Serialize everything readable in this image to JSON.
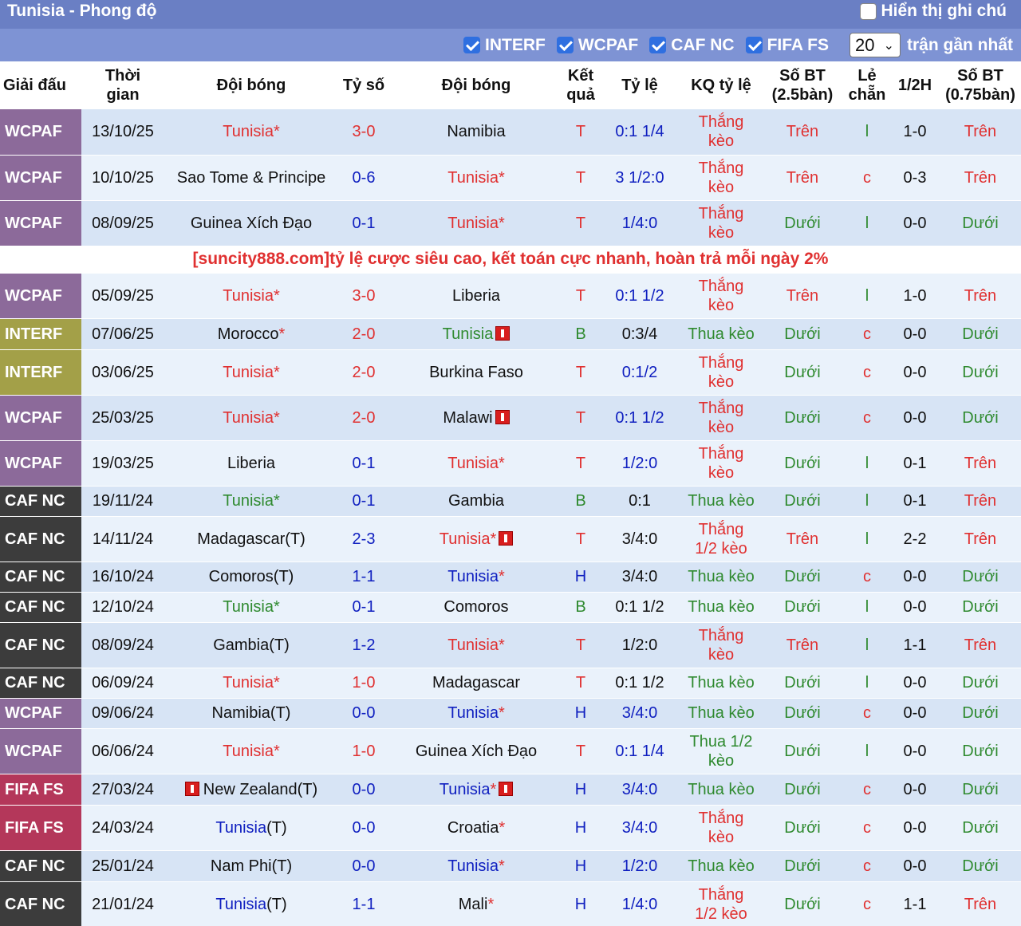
{
  "title": "Tunisia - Phong độ",
  "show_notes_label": "Hiển thị ghi chú",
  "filters": [
    {
      "label": "INTERF",
      "checked": true
    },
    {
      "label": "WCPAF",
      "checked": true
    },
    {
      "label": "CAF NC",
      "checked": true
    },
    {
      "label": "FIFA FS",
      "checked": true
    }
  ],
  "recent_count": "20",
  "recent_suffix": "trận gần nhất",
  "headers": {
    "league": "Giải đấu",
    "time_1": "Thời",
    "time_2": "gian",
    "home": "Đội bóng",
    "score": "Tỷ số",
    "away": "Đội bóng",
    "result_1": "Kết",
    "result_2": "quả",
    "odds": "Tỷ lệ",
    "odds_result": "KQ tỷ lệ",
    "total_1": "Số BT",
    "total_2": "(2.5bàn)",
    "oddeven_1": "Lẻ",
    "oddeven_2": "chẵn",
    "half": "1/2H",
    "total_half_1": "Số BT",
    "total_half_2": "(0.75bàn)"
  },
  "promo": "[suncity888.com]tỷ lệ cược siêu cao, kết toán cực nhanh, hoàn trả mỗi ngày 2%",
  "colors": {
    "title_bar": "#6a7fc4",
    "filter_bar": "#7e93d4",
    "row_dark": "#d7e4f5",
    "row_light": "#eaf2fb",
    "WCPAF": "#8c6a9a",
    "INTERF": "#a3a048",
    "CAF NC": "#3c3c3c",
    "FIFA FS": "#b4375a",
    "win": "#e03030",
    "lose": "#2f8a2f",
    "draw": "#1020c0"
  },
  "rows": [
    {
      "league": "WCPAF",
      "date": "13/10/25",
      "home": "Tunisia",
      "home_star": "*",
      "home_color": "red",
      "score": "3-0",
      "score_color": "red",
      "away": "Namibia",
      "away_star": "",
      "away_color": "dark",
      "result": "T",
      "result_color": "red",
      "odds": "0:1 1/4",
      "odds_color": "blue",
      "odds_result_1": "Thắng",
      "odds_result_2": "kèo",
      "odds_result_color": "red",
      "total": "Trên",
      "total_color": "red",
      "oddeven": "l",
      "oddeven_color": "green",
      "half": "1-0",
      "total_half": "Trên",
      "total_half_color": "red"
    },
    {
      "league": "WCPAF",
      "date": "10/10/25",
      "home": "Sao Tome & Principe",
      "home_star": "",
      "home_color": "dark",
      "score": "0-6",
      "score_color": "blue",
      "away": "Tunisia",
      "away_star": "*",
      "away_color": "red",
      "result": "T",
      "result_color": "red",
      "odds": "3 1/2:0",
      "odds_color": "blue",
      "odds_result_1": "Thắng",
      "odds_result_2": "kèo",
      "odds_result_color": "red",
      "total": "Trên",
      "total_color": "red",
      "oddeven": "c",
      "oddeven_color": "red",
      "half": "0-3",
      "total_half": "Trên",
      "total_half_color": "red"
    },
    {
      "league": "WCPAF",
      "date": "08/09/25",
      "home": "Guinea Xích Đạo",
      "home_star": "",
      "home_color": "dark",
      "score": "0-1",
      "score_color": "blue",
      "away": "Tunisia",
      "away_star": "*",
      "away_color": "red",
      "result": "T",
      "result_color": "red",
      "odds": "1/4:0",
      "odds_color": "blue",
      "odds_result_1": "Thắng",
      "odds_result_2": "kèo",
      "odds_result_color": "red",
      "total": "Dưới",
      "total_color": "green",
      "oddeven": "l",
      "oddeven_color": "green",
      "half": "0-0",
      "total_half": "Dưới",
      "total_half_color": "green"
    },
    {
      "promo": true
    },
    {
      "league": "WCPAF",
      "date": "05/09/25",
      "home": "Tunisia",
      "home_star": "*",
      "home_color": "red",
      "score": "3-0",
      "score_color": "red",
      "away": "Liberia",
      "away_star": "",
      "away_color": "dark",
      "result": "T",
      "result_color": "red",
      "odds": "0:1 1/2",
      "odds_color": "blue",
      "odds_result_1": "Thắng",
      "odds_result_2": "kèo",
      "odds_result_color": "red",
      "total": "Trên",
      "total_color": "red",
      "oddeven": "l",
      "oddeven_color": "green",
      "half": "1-0",
      "total_half": "Trên",
      "total_half_color": "red"
    },
    {
      "league": "INTERF",
      "date": "07/06/25",
      "home": "Morocco",
      "home_star": "*",
      "home_color": "dark",
      "score": "2-0",
      "score_color": "red",
      "away": "Tunisia",
      "away_star": "",
      "away_color": "green",
      "away_card": true,
      "result": "B",
      "result_color": "green",
      "odds": "0:3/4",
      "odds_color": "dark",
      "odds_result_1": "Thua kèo",
      "odds_result_2": "",
      "odds_result_color": "green",
      "total": "Dưới",
      "total_color": "green",
      "oddeven": "c",
      "oddeven_color": "red",
      "half": "0-0",
      "total_half": "Dưới",
      "total_half_color": "green"
    },
    {
      "league": "INTERF",
      "date": "03/06/25",
      "home": "Tunisia",
      "home_star": "*",
      "home_color": "red",
      "score": "2-0",
      "score_color": "red",
      "away": "Burkina Faso",
      "away_star": "",
      "away_color": "dark",
      "result": "T",
      "result_color": "red",
      "odds": "0:1/2",
      "odds_color": "blue",
      "odds_result_1": "Thắng",
      "odds_result_2": "kèo",
      "odds_result_color": "red",
      "total": "Dưới",
      "total_color": "green",
      "oddeven": "c",
      "oddeven_color": "red",
      "half": "0-0",
      "total_half": "Dưới",
      "total_half_color": "green"
    },
    {
      "league": "WCPAF",
      "date": "25/03/25",
      "home": "Tunisia",
      "home_star": "*",
      "home_color": "red",
      "score": "2-0",
      "score_color": "red",
      "away": "Malawi",
      "away_star": "",
      "away_color": "dark",
      "away_card": true,
      "result": "T",
      "result_color": "red",
      "odds": "0:1 1/2",
      "odds_color": "blue",
      "odds_result_1": "Thắng",
      "odds_result_2": "kèo",
      "odds_result_color": "red",
      "total": "Dưới",
      "total_color": "green",
      "oddeven": "c",
      "oddeven_color": "red",
      "half": "0-0",
      "total_half": "Dưới",
      "total_half_color": "green"
    },
    {
      "league": "WCPAF",
      "date": "19/03/25",
      "home": "Liberia",
      "home_star": "",
      "home_color": "dark",
      "score": "0-1",
      "score_color": "blue",
      "away": "Tunisia",
      "away_star": "*",
      "away_color": "red",
      "result": "T",
      "result_color": "red",
      "odds": "1/2:0",
      "odds_color": "blue",
      "odds_result_1": "Thắng",
      "odds_result_2": "kèo",
      "odds_result_color": "red",
      "total": "Dưới",
      "total_color": "green",
      "oddeven": "l",
      "oddeven_color": "green",
      "half": "0-1",
      "total_half": "Trên",
      "total_half_color": "red"
    },
    {
      "league": "CAF NC",
      "date": "19/11/24",
      "home": "Tunisia",
      "home_star": "*",
      "home_color": "green",
      "score": "0-1",
      "score_color": "blue",
      "away": "Gambia",
      "away_star": "",
      "away_color": "dark",
      "result": "B",
      "result_color": "green",
      "odds": "0:1",
      "odds_color": "dark",
      "odds_result_1": "Thua kèo",
      "odds_result_2": "",
      "odds_result_color": "green",
      "total": "Dưới",
      "total_color": "green",
      "oddeven": "l",
      "oddeven_color": "green",
      "half": "0-1",
      "total_half": "Trên",
      "total_half_color": "red"
    },
    {
      "league": "CAF NC",
      "date": "14/11/24",
      "home": "Madagascar(T)",
      "home_star": "",
      "home_color": "dark",
      "score": "2-3",
      "score_color": "blue",
      "away": "Tunisia",
      "away_star": "*",
      "away_color": "red",
      "away_card": true,
      "result": "T",
      "result_color": "red",
      "odds": "3/4:0",
      "odds_color": "dark",
      "odds_result_1": "Thắng",
      "odds_result_2": "1/2 kèo",
      "odds_result_color": "red",
      "total": "Trên",
      "total_color": "red",
      "oddeven": "l",
      "oddeven_color": "green",
      "half": "2-2",
      "total_half": "Trên",
      "total_half_color": "red"
    },
    {
      "league": "CAF NC",
      "date": "16/10/24",
      "home": "Comoros(T)",
      "home_star": "",
      "home_color": "dark",
      "score": "1-1",
      "score_color": "blue",
      "away": "Tunisia",
      "away_star": "*",
      "away_color": "blue",
      "result": "H",
      "result_color": "blue",
      "odds": "3/4:0",
      "odds_color": "dark",
      "odds_result_1": "Thua kèo",
      "odds_result_2": "",
      "odds_result_color": "green",
      "total": "Dưới",
      "total_color": "green",
      "oddeven": "c",
      "oddeven_color": "red",
      "half": "0-0",
      "total_half": "Dưới",
      "total_half_color": "green"
    },
    {
      "league": "CAF NC",
      "date": "12/10/24",
      "home": "Tunisia",
      "home_star": "*",
      "home_color": "green",
      "score": "0-1",
      "score_color": "blue",
      "away": "Comoros",
      "away_star": "",
      "away_color": "dark",
      "result": "B",
      "result_color": "green",
      "odds": "0:1 1/2",
      "odds_color": "dark",
      "odds_result_1": "Thua kèo",
      "odds_result_2": "",
      "odds_result_color": "green",
      "total": "Dưới",
      "total_color": "green",
      "oddeven": "l",
      "oddeven_color": "green",
      "half": "0-0",
      "total_half": "Dưới",
      "total_half_color": "green"
    },
    {
      "league": "CAF NC",
      "date": "08/09/24",
      "home": "Gambia(T)",
      "home_star": "",
      "home_color": "dark",
      "score": "1-2",
      "score_color": "blue",
      "away": "Tunisia",
      "away_star": "*",
      "away_color": "red",
      "result": "T",
      "result_color": "red",
      "odds": "1/2:0",
      "odds_color": "dark",
      "odds_result_1": "Thắng",
      "odds_result_2": "kèo",
      "odds_result_color": "red",
      "total": "Trên",
      "total_color": "red",
      "oddeven": "l",
      "oddeven_color": "green",
      "half": "1-1",
      "total_half": "Trên",
      "total_half_color": "red"
    },
    {
      "league": "CAF NC",
      "date": "06/09/24",
      "home": "Tunisia",
      "home_star": "*",
      "home_color": "red",
      "score": "1-0",
      "score_color": "red",
      "away": "Madagascar",
      "away_star": "",
      "away_color": "dark",
      "result": "T",
      "result_color": "red",
      "odds": "0:1 1/2",
      "odds_color": "dark",
      "odds_result_1": "Thua kèo",
      "odds_result_2": "",
      "odds_result_color": "green",
      "total": "Dưới",
      "total_color": "green",
      "oddeven": "l",
      "oddeven_color": "green",
      "half": "0-0",
      "total_half": "Dưới",
      "total_half_color": "green"
    },
    {
      "league": "WCPAF",
      "date": "09/06/24",
      "home": "Namibia(T)",
      "home_star": "",
      "home_color": "dark",
      "score": "0-0",
      "score_color": "blue",
      "away": "Tunisia",
      "away_star": "*",
      "away_color": "blue",
      "result": "H",
      "result_color": "blue",
      "odds": "3/4:0",
      "odds_color": "blue",
      "odds_result_1": "Thua kèo",
      "odds_result_2": "",
      "odds_result_color": "green",
      "total": "Dưới",
      "total_color": "green",
      "oddeven": "c",
      "oddeven_color": "red",
      "half": "0-0",
      "total_half": "Dưới",
      "total_half_color": "green"
    },
    {
      "league": "WCPAF",
      "date": "06/06/24",
      "home": "Tunisia",
      "home_star": "*",
      "home_color": "red",
      "score": "1-0",
      "score_color": "red",
      "away": "Guinea Xích Đạo",
      "away_star": "",
      "away_color": "dark",
      "result": "T",
      "result_color": "red",
      "odds": "0:1 1/4",
      "odds_color": "blue",
      "odds_result_1": "Thua 1/2",
      "odds_result_2": "kèo",
      "odds_result_color": "green",
      "total": "Dưới",
      "total_color": "green",
      "oddeven": "l",
      "oddeven_color": "green",
      "half": "0-0",
      "total_half": "Dưới",
      "total_half_color": "green"
    },
    {
      "league": "FIFA FS",
      "date": "27/03/24",
      "home": "New Zealand(T)",
      "home_star": "",
      "home_color": "dark",
      "home_card": true,
      "score": "0-0",
      "score_color": "blue",
      "away": "Tunisia",
      "away_star": "*",
      "away_color": "blue",
      "away_card": true,
      "result": "H",
      "result_color": "blue",
      "odds": "3/4:0",
      "odds_color": "blue",
      "odds_result_1": "Thua kèo",
      "odds_result_2": "",
      "odds_result_color": "green",
      "total": "Dưới",
      "total_color": "green",
      "oddeven": "c",
      "oddeven_color": "red",
      "half": "0-0",
      "total_half": "Dưới",
      "total_half_color": "green"
    },
    {
      "league": "FIFA FS",
      "date": "24/03/24",
      "home": "Tunisia",
      "home_suffix": "(T)",
      "home_star": "",
      "home_color": "blue",
      "score": "0-0",
      "score_color": "blue",
      "away": "Croatia",
      "away_star": "*",
      "away_color": "dark",
      "result": "H",
      "result_color": "blue",
      "odds": "3/4:0",
      "odds_color": "blue",
      "odds_result_1": "Thắng",
      "odds_result_2": "kèo",
      "odds_result_color": "red",
      "total": "Dưới",
      "total_color": "green",
      "oddeven": "c",
      "oddeven_color": "red",
      "half": "0-0",
      "total_half": "Dưới",
      "total_half_color": "green"
    },
    {
      "league": "CAF NC",
      "date": "25/01/24",
      "home": "Nam Phi(T)",
      "home_star": "",
      "home_color": "dark",
      "score": "0-0",
      "score_color": "blue",
      "away": "Tunisia",
      "away_star": "*",
      "away_color": "blue",
      "result": "H",
      "result_color": "blue",
      "odds": "1/2:0",
      "odds_color": "blue",
      "odds_result_1": "Thua kèo",
      "odds_result_2": "",
      "odds_result_color": "green",
      "total": "Dưới",
      "total_color": "green",
      "oddeven": "c",
      "oddeven_color": "red",
      "half": "0-0",
      "total_half": "Dưới",
      "total_half_color": "green"
    },
    {
      "league": "CAF NC",
      "date": "21/01/24",
      "home": "Tunisia",
      "home_suffix": "(T)",
      "home_star": "",
      "home_color": "blue",
      "score": "1-1",
      "score_color": "blue",
      "away": "Mali",
      "away_star": "*",
      "away_color": "dark",
      "result": "H",
      "result_color": "blue",
      "odds": "1/4:0",
      "odds_color": "blue",
      "odds_result_1": "Thắng",
      "odds_result_2": "1/2 kèo",
      "odds_result_color": "red",
      "total": "Dưới",
      "total_color": "green",
      "oddeven": "c",
      "oddeven_color": "red",
      "half": "1-1",
      "total_half": "Trên",
      "total_half_color": "red"
    }
  ]
}
